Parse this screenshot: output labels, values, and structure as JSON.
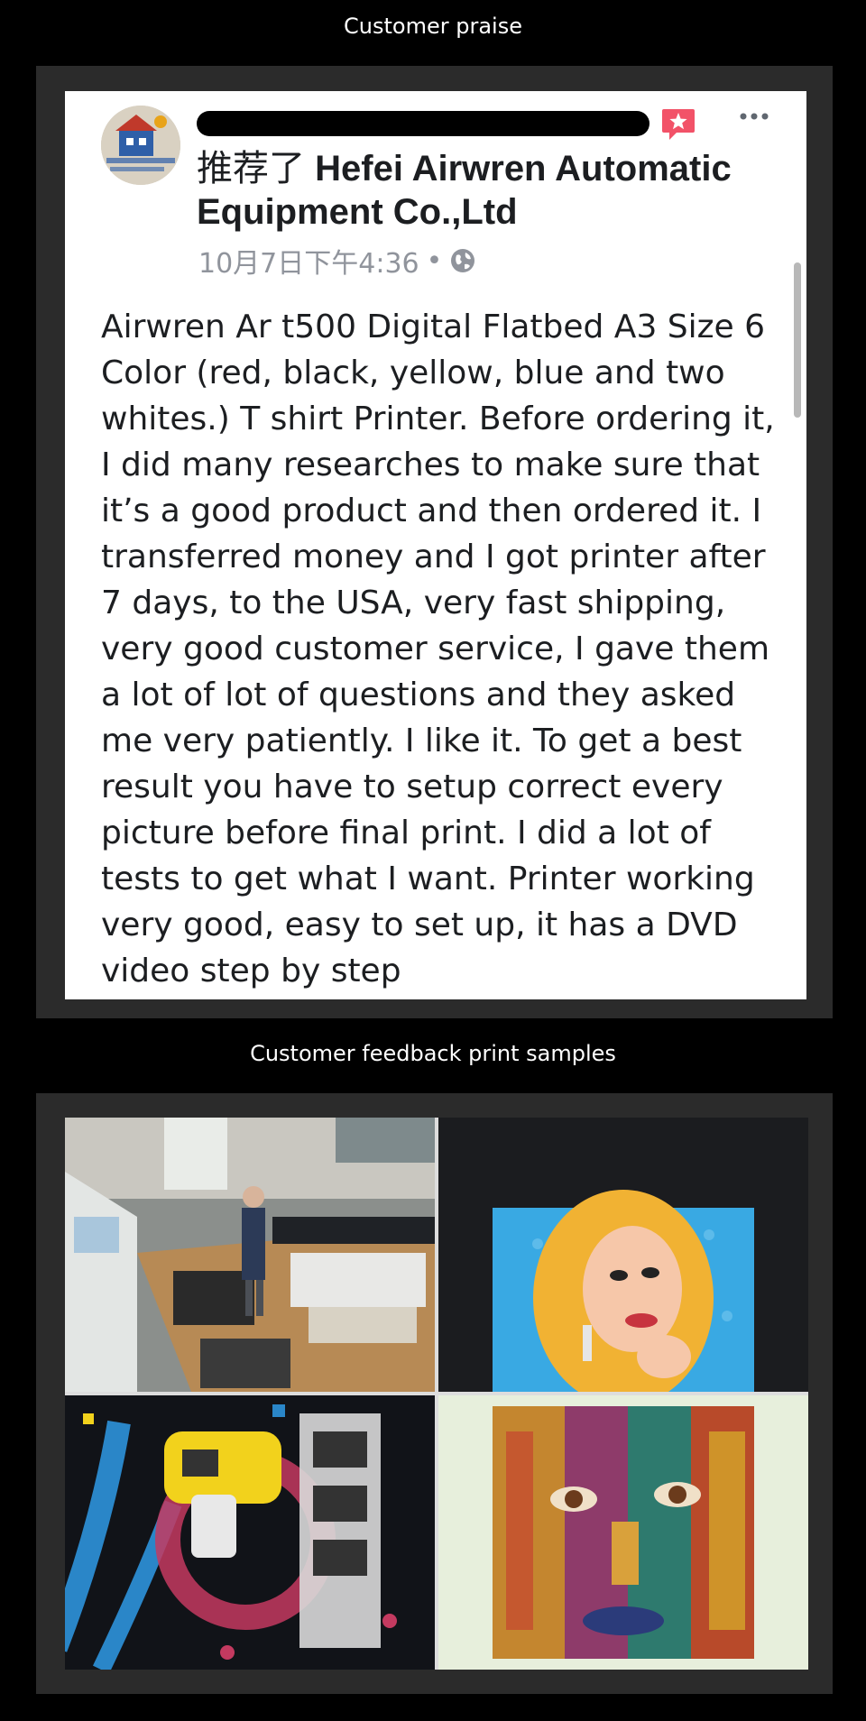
{
  "sections": {
    "praise_title": "Customer praise",
    "samples_title": "Customer feedback print samples"
  },
  "post": {
    "recommend_prefix": "推荐了",
    "company_name": "Hefei Airwren Automatic Equipment Co.,Ltd",
    "timestamp": "10月7日下午4:36",
    "separator": "•",
    "body": "Airwren Ar t500 Digital Flatbed A3 Size 6 Color (red, black, yellow, blue and two whites.) T shirt Printer. Before ordering it, I did many researches to make sure that it’s a good product and then ordered it.  I transferred money and I got printer after 7 days, to the USA, very fast shipping, very good customer service, I gave them a lot of lot of questions and they asked me very patiently. I like it. To get a best result you have to setup correct every picture before final print. I did a lot of tests to get what I want. Printer working very good, easy to set up, it has a DVD video step by step",
    "icons": [
      "avatar",
      "recommend-badge-icon",
      "more-options-icon",
      "globe-icon"
    ]
  },
  "samples": {
    "photos": [
      {
        "name": "workshop-photo"
      },
      {
        "name": "pop-art-woman-shirt-photo"
      },
      {
        "name": "aruba-carnival-shirt-photo"
      },
      {
        "name": "painted-face-shirt-photo"
      }
    ]
  }
}
